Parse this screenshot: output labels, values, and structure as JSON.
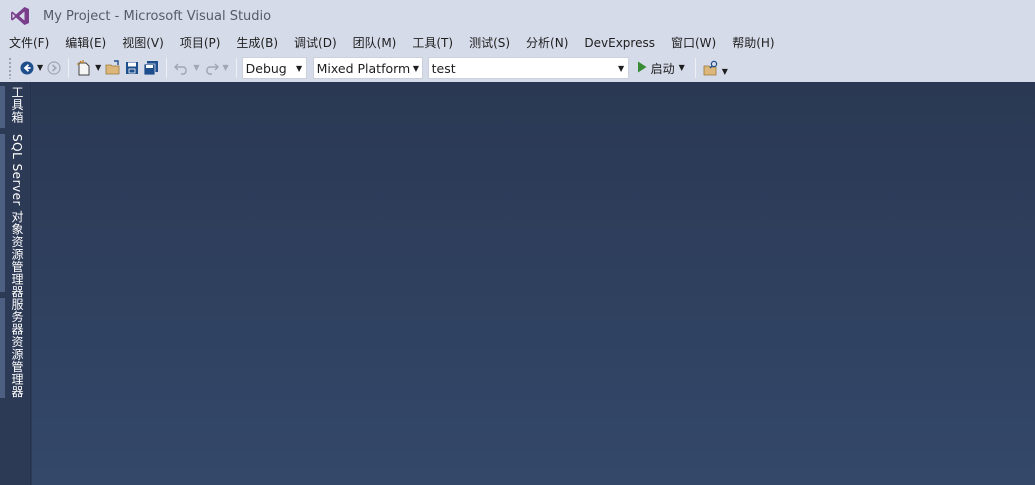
{
  "window": {
    "title": "My Project - Microsoft Visual Studio",
    "logo_icon": "visual-studio-logo-icon"
  },
  "menubar": {
    "items": [
      "文件(F)",
      "编辑(E)",
      "视图(V)",
      "项目(P)",
      "生成(B)",
      "调试(D)",
      "团队(M)",
      "工具(T)",
      "测试(S)",
      "分析(N)",
      "DevExpress",
      "窗口(W)",
      "帮助(H)"
    ]
  },
  "toolbar": {
    "config_value": "Debug",
    "platform_value": "Mixed Platform",
    "startup_project_value": "test",
    "start_label": "启动",
    "icons": [
      "back-icon",
      "forward-icon",
      "new-project-icon",
      "open-file-icon",
      "save-icon",
      "save-all-icon",
      "undo-icon",
      "redo-icon",
      "start-icon",
      "find-in-files-icon"
    ]
  },
  "sidebar": {
    "tabs": [
      "工具箱",
      "SQL Server 对象资源管理器",
      "服务器资源管理器"
    ]
  },
  "colors": {
    "chrome": "#d6dbe9",
    "editor_background": "#2b3a56",
    "accent_start": "#388a34"
  }
}
